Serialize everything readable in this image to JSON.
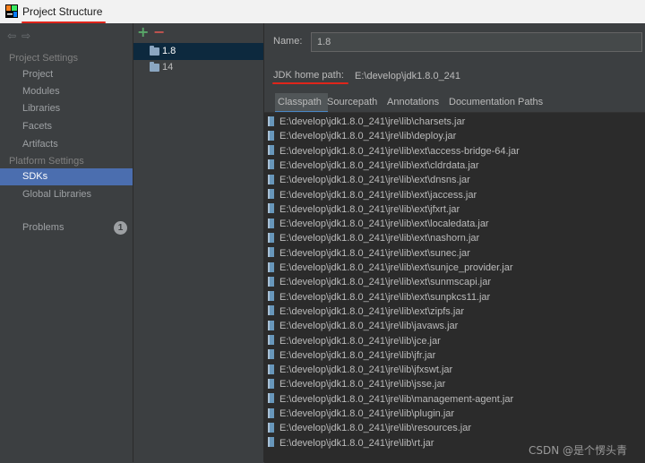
{
  "window": {
    "title": "Project Structure"
  },
  "sidebar": {
    "nav_back": "⇦",
    "nav_forward": "⇨",
    "project_settings_header": "Project Settings",
    "project_items": [
      "Project",
      "Modules",
      "Libraries",
      "Facets",
      "Artifacts"
    ],
    "platform_settings_header": "Platform Settings",
    "platform_items": [
      "SDKs",
      "Global Libraries"
    ],
    "selected_item": "SDKs",
    "problems_label": "Problems",
    "problems_count": "1"
  },
  "sdk_list": {
    "add_icon": "+",
    "remove_icon": "−",
    "items": [
      "1.8",
      "14"
    ],
    "selected": "1.8"
  },
  "details": {
    "name_label": "Name:",
    "name_value": "1.8",
    "home_label": "JDK home path:",
    "home_value": "E:\\develop\\jdk1.8.0_241",
    "tabs": [
      "Classpath",
      "Sourcepath",
      "Annotations",
      "Documentation Paths"
    ],
    "active_tab": "Classpath",
    "classpath": [
      "E:\\develop\\jdk1.8.0_241\\jre\\lib\\charsets.jar",
      "E:\\develop\\jdk1.8.0_241\\jre\\lib\\deploy.jar",
      "E:\\develop\\jdk1.8.0_241\\jre\\lib\\ext\\access-bridge-64.jar",
      "E:\\develop\\jdk1.8.0_241\\jre\\lib\\ext\\cldrdata.jar",
      "E:\\develop\\jdk1.8.0_241\\jre\\lib\\ext\\dnsns.jar",
      "E:\\develop\\jdk1.8.0_241\\jre\\lib\\ext\\jaccess.jar",
      "E:\\develop\\jdk1.8.0_241\\jre\\lib\\ext\\jfxrt.jar",
      "E:\\develop\\jdk1.8.0_241\\jre\\lib\\ext\\localedata.jar",
      "E:\\develop\\jdk1.8.0_241\\jre\\lib\\ext\\nashorn.jar",
      "E:\\develop\\jdk1.8.0_241\\jre\\lib\\ext\\sunec.jar",
      "E:\\develop\\jdk1.8.0_241\\jre\\lib\\ext\\sunjce_provider.jar",
      "E:\\develop\\jdk1.8.0_241\\jre\\lib\\ext\\sunmscapi.jar",
      "E:\\develop\\jdk1.8.0_241\\jre\\lib\\ext\\sunpkcs11.jar",
      "E:\\develop\\jdk1.8.0_241\\jre\\lib\\ext\\zipfs.jar",
      "E:\\develop\\jdk1.8.0_241\\jre\\lib\\javaws.jar",
      "E:\\develop\\jdk1.8.0_241\\jre\\lib\\jce.jar",
      "E:\\develop\\jdk1.8.0_241\\jre\\lib\\jfr.jar",
      "E:\\develop\\jdk1.8.0_241\\jre\\lib\\jfxswt.jar",
      "E:\\develop\\jdk1.8.0_241\\jre\\lib\\jsse.jar",
      "E:\\develop\\jdk1.8.0_241\\jre\\lib\\management-agent.jar",
      "E:\\develop\\jdk1.8.0_241\\jre\\lib\\plugin.jar",
      "E:\\develop\\jdk1.8.0_241\\jre\\lib\\resources.jar",
      "E:\\develop\\jdk1.8.0_241\\jre\\lib\\rt.jar"
    ]
  },
  "watermark": "CSDN @是个愣头青",
  "colors": {
    "accent_selection": "#4b6eaf",
    "annotation_underline": "#e0251b",
    "add": "#59a869",
    "remove": "#c75450"
  }
}
